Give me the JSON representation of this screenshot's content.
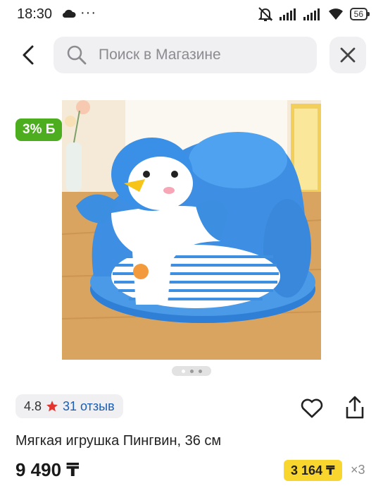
{
  "status_bar": {
    "time": "18:30",
    "battery": "56"
  },
  "search": {
    "placeholder": "Поиск в Магазине"
  },
  "product": {
    "cashback_badge": "3% Б",
    "rating": "4.8",
    "reviews": "31 отзыв",
    "title": "Мягкая игрушка Пингвин, 36 см",
    "price": "9 490 ₸",
    "installment_price": "3 164 ₸",
    "installment_multiplier": "×3",
    "gallery": {
      "slides": 3,
      "active_index": 0
    }
  },
  "colors": {
    "badge_green": "#4cae1e",
    "installment_yellow": "#f9d62e",
    "link_blue": "#1a5fb4",
    "star_red": "#e3342f"
  },
  "icons": [
    "cloud-icon",
    "more-dots-icon",
    "mute-bell-icon",
    "signal-icon",
    "wifi-icon",
    "battery-icon",
    "back-arrow-icon",
    "search-icon",
    "close-icon",
    "star-icon",
    "heart-icon",
    "share-icon"
  ]
}
